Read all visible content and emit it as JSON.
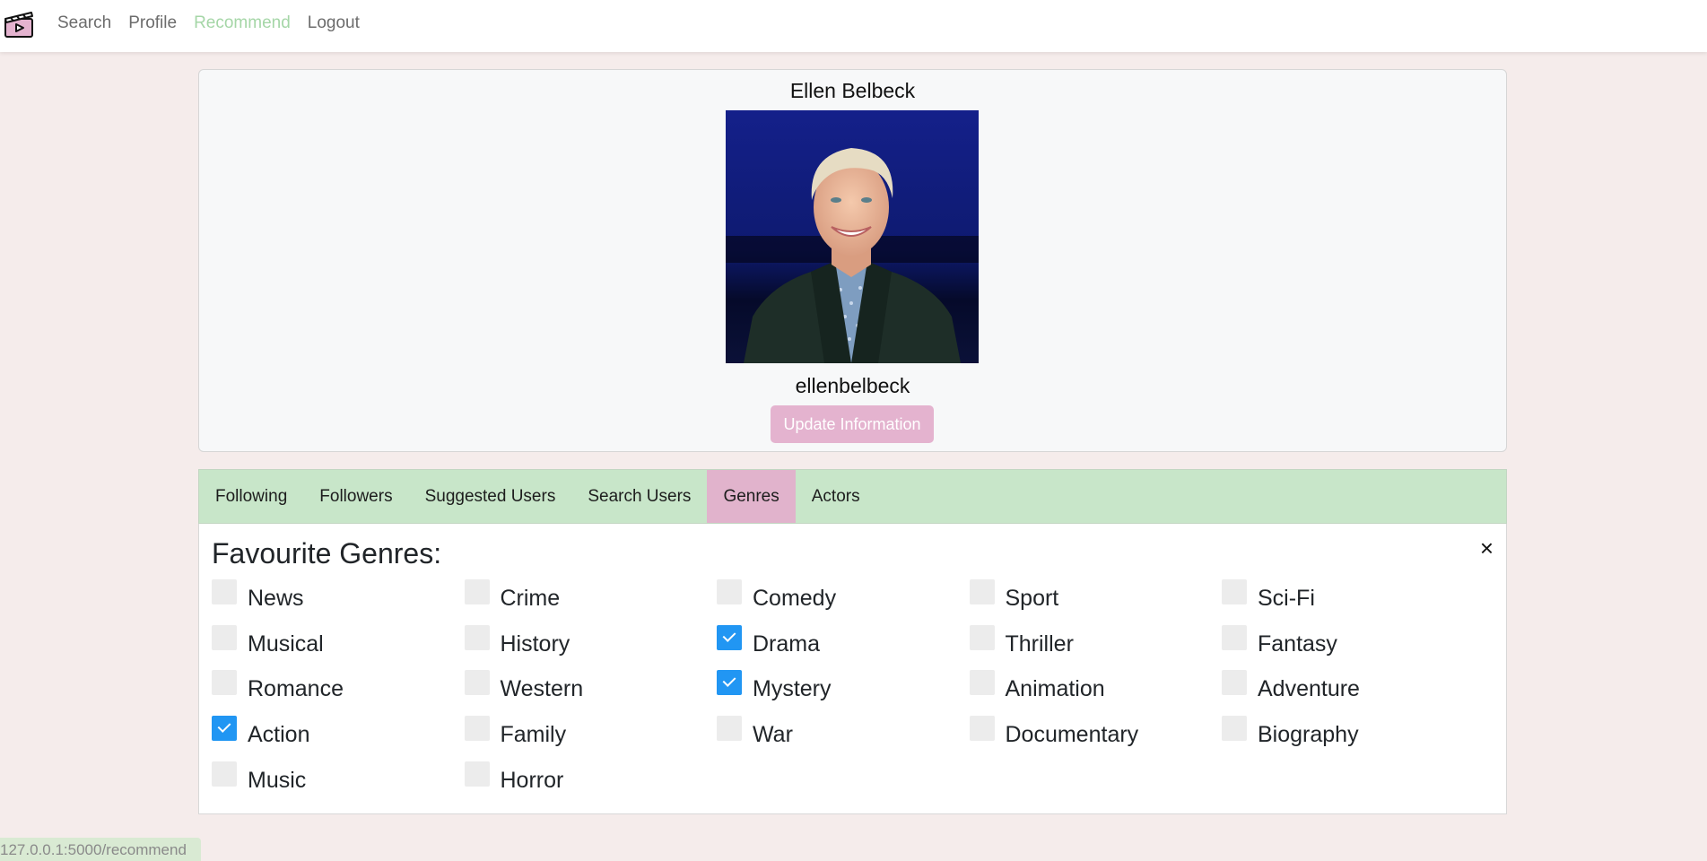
{
  "nav": {
    "links": [
      "Search",
      "Profile",
      "Recommend",
      "Logout"
    ],
    "active": "Recommend",
    "active_color": "#a5d6a7"
  },
  "profile": {
    "name": "Ellen Belbeck",
    "username": "ellenbelbeck",
    "update_button": "Update Information",
    "button_color": "#e4b3cf"
  },
  "tabs": {
    "items": [
      "Following",
      "Followers",
      "Suggested Users",
      "Search Users",
      "Genres",
      "Actors"
    ],
    "active": "Genres",
    "bar_color": "#c8e6c9",
    "active_color": "#e1b3cc"
  },
  "genres": {
    "title": "Favourite Genres:",
    "close_icon": "×",
    "items": [
      {
        "label": "News",
        "checked": false
      },
      {
        "label": "Crime",
        "checked": false
      },
      {
        "label": "Comedy",
        "checked": false
      },
      {
        "label": "Sport",
        "checked": false
      },
      {
        "label": "Sci-Fi",
        "checked": false
      },
      {
        "label": "Musical",
        "checked": false
      },
      {
        "label": "History",
        "checked": false
      },
      {
        "label": "Drama",
        "checked": true
      },
      {
        "label": "Thriller",
        "checked": false
      },
      {
        "label": "Fantasy",
        "checked": false
      },
      {
        "label": "Romance",
        "checked": false
      },
      {
        "label": "Western",
        "checked": false
      },
      {
        "label": "Mystery",
        "checked": true
      },
      {
        "label": "Animation",
        "checked": false
      },
      {
        "label": "Adventure",
        "checked": false
      },
      {
        "label": "Action",
        "checked": true
      },
      {
        "label": "Family",
        "checked": false
      },
      {
        "label": "War",
        "checked": false
      },
      {
        "label": "Documentary",
        "checked": false
      },
      {
        "label": "Biography",
        "checked": false
      },
      {
        "label": "Music",
        "checked": false
      },
      {
        "label": "Horror",
        "checked": false
      }
    ],
    "checked_color": "#2196f3"
  },
  "status_bar": {
    "url": "127.0.0.1:5000/recommend"
  }
}
